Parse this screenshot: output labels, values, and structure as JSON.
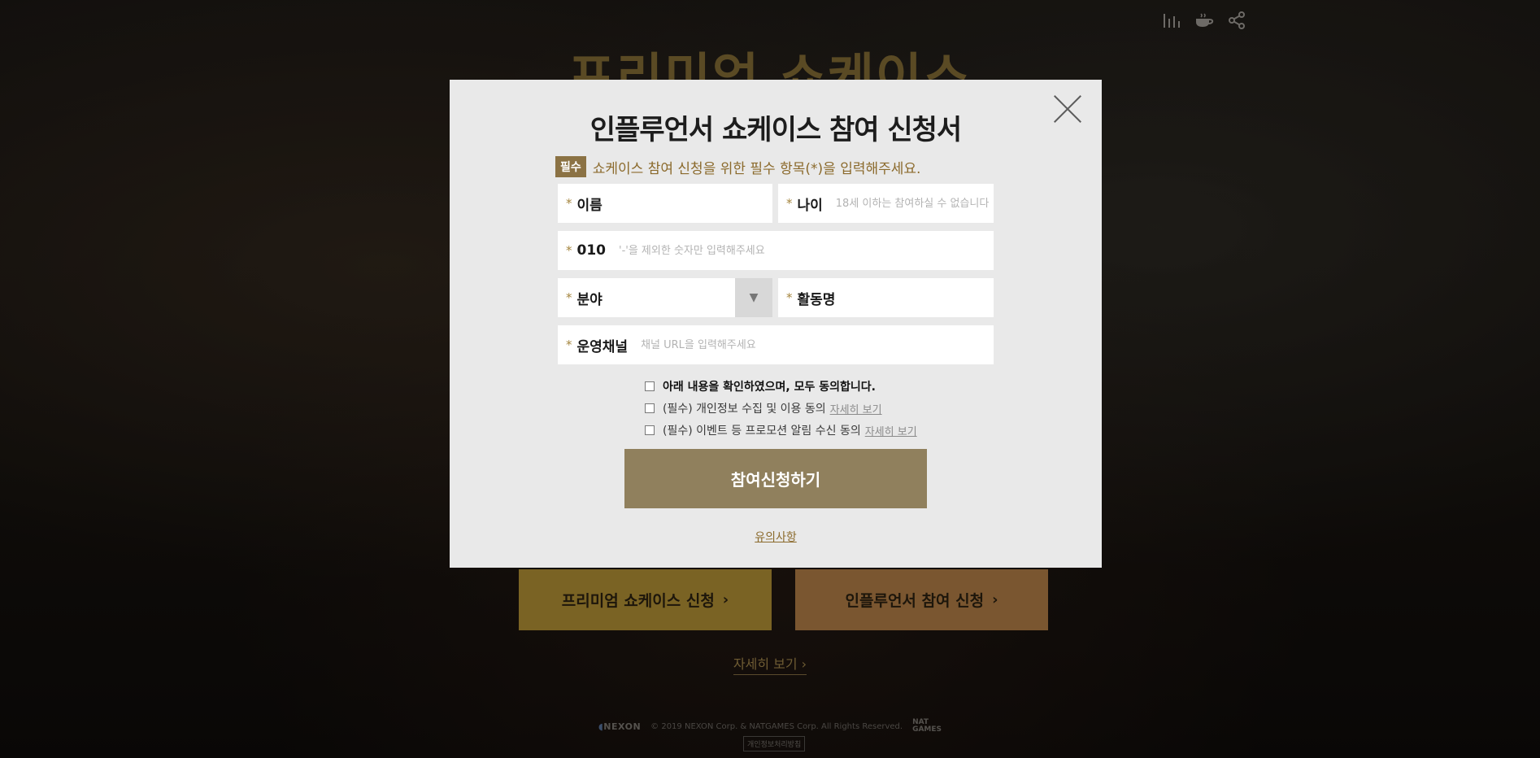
{
  "background": {
    "title": "프리미엄 쇼케이스",
    "cta_buttons": [
      {
        "label": "프리미엄 쇼케이스 신청",
        "chevron": "›"
      },
      {
        "label": "인플루언서 참여 신청",
        "chevron": "›"
      }
    ],
    "more_link": "자세히 보기 ›",
    "footer": {
      "nexon_logo": "NEXON",
      "copyright": "© 2019 NEXON Corp. & NATGAMES Corp. All Rights Reserved.",
      "nat_logo_top": "NAT",
      "nat_logo_bottom": "GAMES",
      "privacy_link": "개인정보처리방침"
    },
    "top_icons": [
      "bar-chart-icon",
      "coffee-cup-icon",
      "share-icon"
    ]
  },
  "modal": {
    "title": "인플루언서 쇼케이스 참여 신청서",
    "required_badge": "필수",
    "required_text": "쇼케이스 참여 신청을 위한 필수 항목(*)을 입력해주세요.",
    "fields": {
      "star": "*",
      "name": {
        "label": "이름",
        "placeholder": ""
      },
      "age": {
        "label": "나이",
        "placeholder": "18세 이하는 참여하실 수 없습니다"
      },
      "phone": {
        "label": "010",
        "placeholder": "'-'을 제외한 숫자만 입력해주세요"
      },
      "category": {
        "label": "분야",
        "arrow": "▼"
      },
      "activity_name": {
        "label": "활동명",
        "placeholder": ""
      },
      "channel": {
        "label": "운영채널",
        "placeholder": "채널 URL을 입력해주세요"
      }
    },
    "agreements": {
      "all": "아래 내용을 확인하였으며, 모두 동의합니다.",
      "privacy": "(필수) 개인정보 수집 및 이용 동의",
      "promotion": "(필수) 이벤트 등 프로모션 알림 수신 동의",
      "detail_link": "자세히 보기"
    },
    "submit_label": "참여신청하기",
    "notice_link": "유의사항"
  },
  "colors": {
    "modal_bg": "#e9e9e9",
    "accent_gold": "#8b7244",
    "submit_bg": "#90805d",
    "premium_cta": "#7a6324",
    "influencer_cta": "#7a5630"
  }
}
